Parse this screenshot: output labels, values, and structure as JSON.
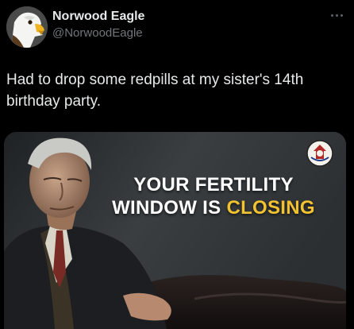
{
  "author": {
    "display_name": "Norwood Eagle",
    "handle": "@NorwoodEagle",
    "avatar_icon": "eagle-head-icon"
  },
  "post": {
    "text": "Had to drop some redpills at my sister's 14th birthday party."
  },
  "media": {
    "headline_line1": "YOUR FERTILITY",
    "headline_line2_plain": "WINDOW IS",
    "headline_line2_accent": "CLOSING",
    "accent_color": "#f2c230",
    "logo_icon": "channel-logo-icon"
  },
  "colors": {
    "background": "#000000",
    "primary_text": "#e7e9ea",
    "secondary_text": "#71767b"
  }
}
